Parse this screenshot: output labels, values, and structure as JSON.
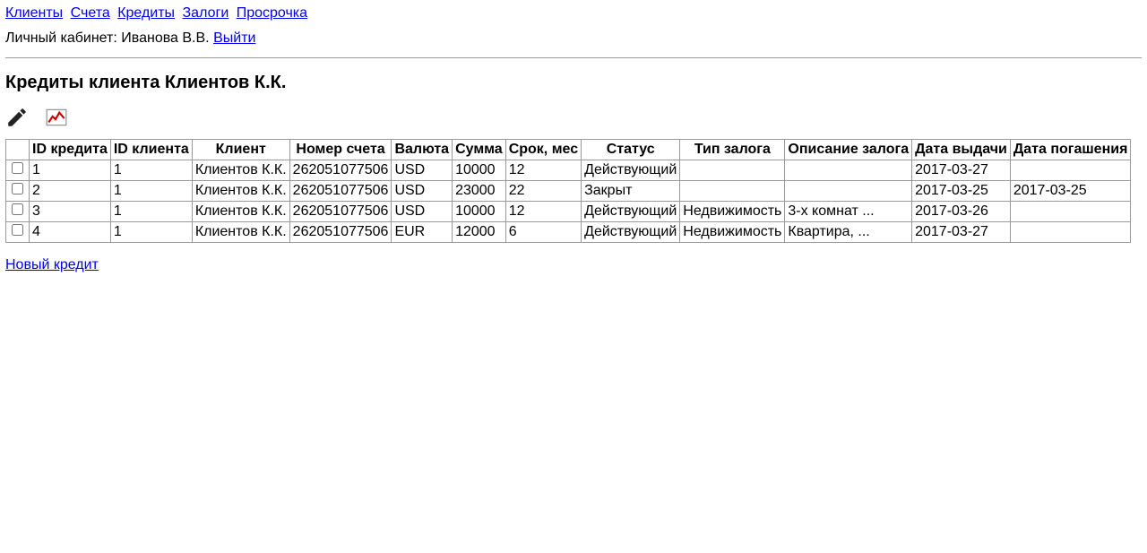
{
  "nav": {
    "clients": "Клиенты",
    "accounts": "Счета",
    "credits": "Кредиты",
    "pledges": "Залоги",
    "overdue": "Просрочка"
  },
  "account": {
    "prefix": "Личный кабинет: Иванова В.В.",
    "logout": "Выйти"
  },
  "page": {
    "title": "Кредиты клиента Клиентов К.К."
  },
  "icons": {
    "edit": "edit-icon",
    "graph": "graph-icon"
  },
  "table": {
    "headers": [
      "",
      "ID кредита",
      "ID клиента",
      "Клиент",
      "Номер счета",
      "Валюта",
      "Сумма",
      "Срок, мес",
      "Статус",
      "Тип залога",
      "Описание залога",
      "Дата выдачи",
      "Дата погашения"
    ],
    "rows": [
      {
        "credit_id": "1",
        "client_id": "1",
        "client": "Клиентов К.К.",
        "account": "262051077506",
        "currency": "USD",
        "amount": "10000",
        "term": "12",
        "status": "Действующий",
        "pledge_type": "",
        "pledge_desc": "",
        "issue_date": "2017-03-27",
        "repay_date": ""
      },
      {
        "credit_id": "2",
        "client_id": "1",
        "client": "Клиентов К.К.",
        "account": "262051077506",
        "currency": "USD",
        "amount": "23000",
        "term": "22",
        "status": "Закрыт",
        "pledge_type": "",
        "pledge_desc": "",
        "issue_date": "2017-03-25",
        "repay_date": "2017-03-25"
      },
      {
        "credit_id": "3",
        "client_id": "1",
        "client": "Клиентов К.К.",
        "account": "262051077506",
        "currency": "USD",
        "amount": "10000",
        "term": "12",
        "status": "Действующий",
        "pledge_type": "Недвижимость",
        "pledge_desc": "3-х комнат ...",
        "issue_date": "2017-03-26",
        "repay_date": ""
      },
      {
        "credit_id": "4",
        "client_id": "1",
        "client": "Клиентов К.К.",
        "account": "262051077506",
        "currency": "EUR",
        "amount": "12000",
        "term": "6",
        "status": "Действующий",
        "pledge_type": "Недвижимость",
        "pledge_desc": "Квартира, ...",
        "issue_date": "2017-03-27",
        "repay_date": ""
      }
    ]
  },
  "new_credit": "Новый кредит"
}
